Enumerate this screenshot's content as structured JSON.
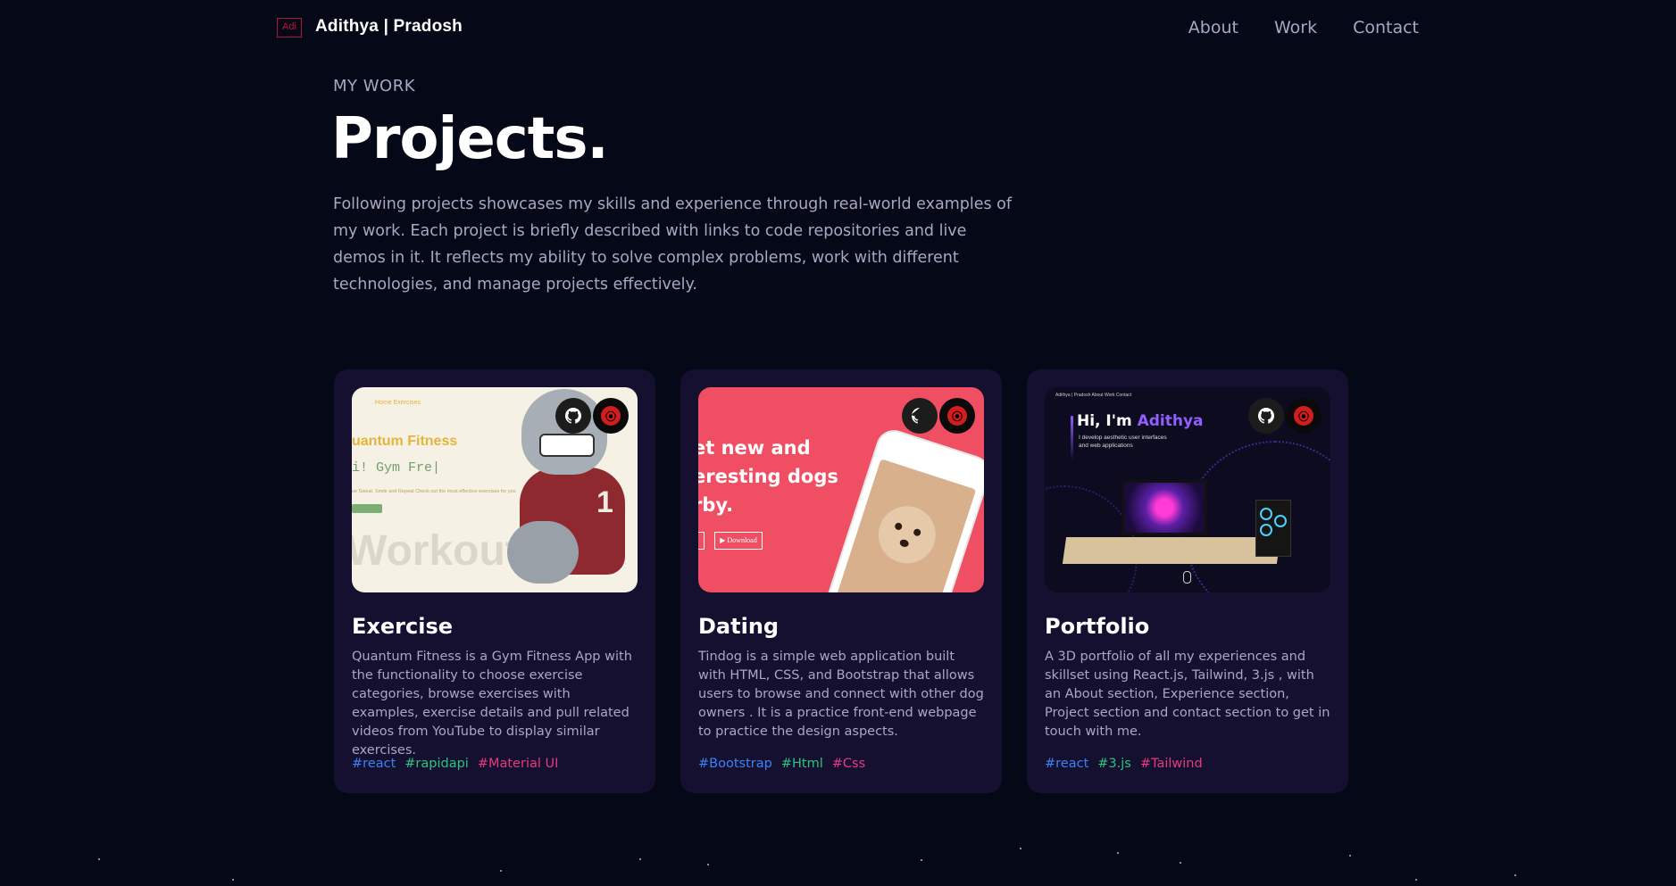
{
  "nav": {
    "logo_text": "Adi",
    "brand_first": "Adithya",
    "brand_second": "| Pradosh",
    "links": [
      "About",
      "Work",
      "Contact"
    ]
  },
  "header": {
    "kicker": "MY WORK",
    "title": "Projects.",
    "intro": "Following projects showcases my skills and experience through real-world examples of my work. Each project is briefly described with links to code repositories and live demos in it. It reflects my ability to solve complex problems, work with different technologies, and manage projects effectively."
  },
  "projects": [
    {
      "name": "Exercise",
      "description": "Quantum Fitness is a Gym Fitness App with the functionality to choose exercise categories, browse exercises with examples, exercise details and pull related videos from YouTube to display similar exercises.",
      "tags": [
        {
          "label": "#react",
          "color": "#3b82f6"
        },
        {
          "label": "#rapidapi",
          "color": "#2ec27e"
        },
        {
          "label": "#Material UI",
          "color": "#e23b7e"
        }
      ],
      "preview": {
        "nav": "Home   Exercises",
        "heading": "uantum Fitness",
        "typed": "i! Gym Fre|",
        "tagline": "ue  Sweat, Smile  and  Repeat  Check out the most effective exercises for you",
        "big": "Workout",
        "badge": "1"
      }
    },
    {
      "name": "Dating",
      "description": "Tindog is a simple web application built with HTML, CSS, and Bootstrap that allows users to browse and connect with other dog owners . It is a practice front-end webpage to practice the design aspects.",
      "tags": [
        {
          "label": "#Bootstrap",
          "color": "#3b82f6"
        },
        {
          "label": "#Html",
          "color": "#2ec27e"
        },
        {
          "label": "#Css",
          "color": "#e23b7e"
        }
      ],
      "preview": {
        "lines": [
          "et new and",
          "eresting dogs",
          "rby."
        ],
        "download": "▶ Download"
      }
    },
    {
      "name": "Portfolio",
      "description": "A 3D portfolio of all my experiences and skillset using React.js, Tailwind, 3.js , with an About section, Experience section, Project section and contact section to get in touch with me.",
      "tags": [
        {
          "label": "#react",
          "color": "#3b82f6"
        },
        {
          "label": "#3.js",
          "color": "#2ec27e"
        },
        {
          "label": "#Tailwind",
          "color": "#e23b7e"
        }
      ],
      "preview": {
        "mini_nav": "Adithya | Pradosh        About   Work   Contact",
        "hi": "Hi, I'm ",
        "hi_name": "Adithya",
        "sub": "I develop aesthetic user interfaces and web applications"
      }
    }
  ],
  "icons": {
    "github": "github-icon",
    "live": "live-demo-icon"
  },
  "colors": {
    "background": "#050816",
    "card": "#151030",
    "secondary_text": "#aaa6c3",
    "accent": "#915eff"
  }
}
